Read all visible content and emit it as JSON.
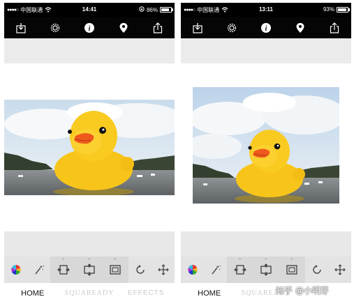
{
  "screens": [
    {
      "status": {
        "signal": "●●●●○",
        "carrier": "中国联通",
        "time": "14:41",
        "battery": "86%",
        "battery_level": 0.86,
        "show_lock": true
      },
      "toolbar_icons": [
        "download-icon",
        "gear-icon",
        "info-icon",
        "location-pin-icon",
        "share-icon"
      ],
      "bottom_tools": [
        "color-wheel-icon",
        "magic-wand-icon",
        "fit-horizontal-icon",
        "fit-vertical-icon",
        "square-frame-icon",
        "rotate-icon",
        "move-icon"
      ],
      "nav": {
        "home": "HOME",
        "squaready": "SQUAREADY",
        "effects": "EFFECTS"
      }
    },
    {
      "status": {
        "signal": "●●●●○",
        "carrier": "中国联通",
        "time": "13:11",
        "battery": "93%",
        "battery_level": 0.93,
        "show_lock": false
      },
      "toolbar_icons": [
        "download-icon",
        "gear-icon",
        "info-icon",
        "location-pin-icon",
        "share-icon"
      ],
      "bottom_tools": [
        "color-wheel-icon",
        "magic-wand-icon",
        "fit-horizontal-icon",
        "fit-vertical-icon",
        "square-frame-icon",
        "rotate-icon",
        "move-icon"
      ],
      "nav": {
        "home": "HOME",
        "squaready": "SQUAREADY"
      }
    }
  ],
  "watermark": "知乎 @小明芽",
  "colors": {
    "toolbar_bg": "#050505",
    "tool_bar_bg": "#e3e3e3",
    "duck_yellow": "#f7c51a",
    "beak_orange": "#ef5a1c",
    "water": "#6f7274",
    "sky": "#d9e6f2"
  }
}
